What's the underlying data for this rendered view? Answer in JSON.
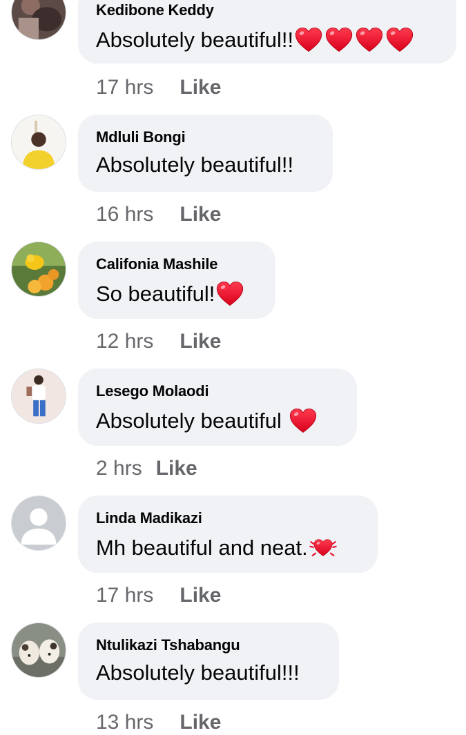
{
  "comments": [
    {
      "author": "Kedibone Keddy",
      "text": "Absolutely beautiful!!",
      "emoji": "red-heart x4",
      "time": "17 hrs",
      "like_label": "Like"
    },
    {
      "author": "Mdluli Bongi",
      "text": "Absolutely beautiful!!",
      "emoji": "",
      "time": "16 hrs",
      "like_label": "Like"
    },
    {
      "author": "Califonia Mashile",
      "text": "So beautiful!",
      "emoji": "red-heart",
      "time": "12 hrs",
      "like_label": "Like"
    },
    {
      "author": "Lesego Molaodi",
      "text": "Absolutely beautiful",
      "emoji": "red-heart",
      "time": "2 hrs",
      "like_label": "Like"
    },
    {
      "author": "Linda Madikazi",
      "text": "Mh beautiful and neat.",
      "emoji": "beating-heart",
      "time": "17 hrs",
      "like_label": "Like"
    },
    {
      "author": "Ntulikazi Tshabangu",
      "text": "Absolutely beautiful!!!",
      "emoji": "",
      "time": "13 hrs",
      "like_label": "Like"
    }
  ],
  "colors": {
    "bubble_bg": "#f0f2f5",
    "meta_text": "#65676b",
    "author_text": "#050505",
    "heart": "#e8132f"
  }
}
